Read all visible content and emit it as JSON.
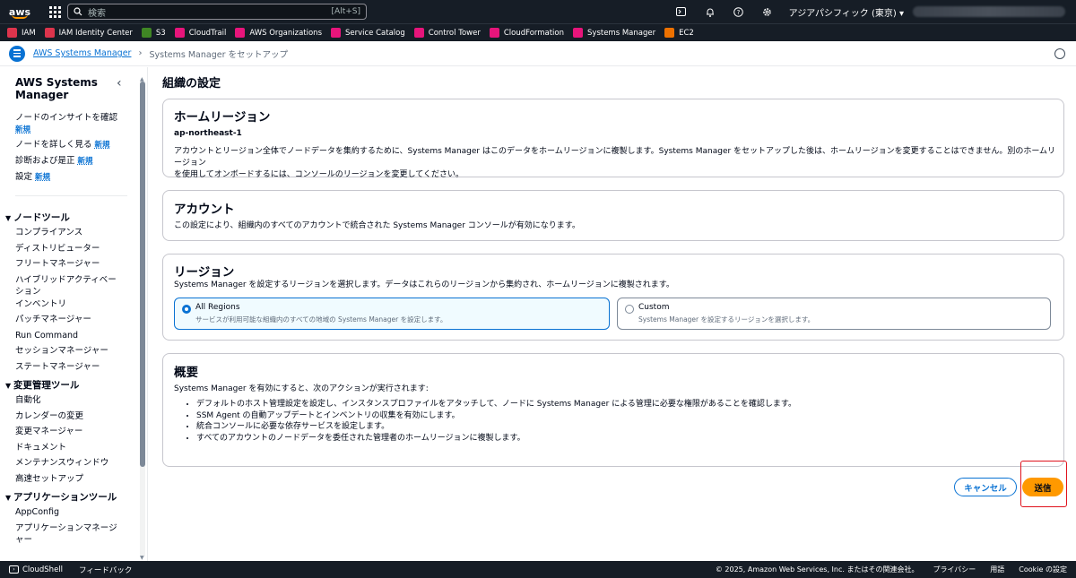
{
  "topbar": {
    "logo": "aws",
    "search_placeholder": "検索",
    "search_shortcut": "[Alt+S]",
    "region": "アジアパシフィック (東京) ▾",
    "icons": [
      "cloudshell-icon",
      "bell-icon",
      "help-icon",
      "gear-icon"
    ]
  },
  "favorites": [
    {
      "label": "IAM",
      "color": "#dd344c"
    },
    {
      "label": "IAM Identity Center",
      "color": "#dd344c"
    },
    {
      "label": "S3",
      "color": "#3f8624"
    },
    {
      "label": "CloudTrail",
      "color": "#e7157b"
    },
    {
      "label": "AWS Organizations",
      "color": "#e7157b"
    },
    {
      "label": "Service Catalog",
      "color": "#e7157b"
    },
    {
      "label": "Control Tower",
      "color": "#e7157b"
    },
    {
      "label": "CloudFormation",
      "color": "#e7157b"
    },
    {
      "label": "Systems Manager",
      "color": "#e7157b"
    },
    {
      "label": "EC2",
      "color": "#ed7100"
    }
  ],
  "breadcrumb": {
    "link": "AWS Systems Manager",
    "current": "Systems Manager をセットアップ"
  },
  "sidebar": {
    "title": "AWS Systems Manager",
    "new_badge": "新規",
    "top_items": [
      "ノードのインサイトを確認",
      "ノードを詳しく見る",
      "診断および是正",
      "設定"
    ],
    "sections": [
      {
        "title": "ノードツール",
        "items": [
          "コンプライアンス",
          "ディストリビューター",
          "フリートマネージャー",
          "ハイブリッドアクティベーション",
          "インベントリ",
          "パッチマネージャー",
          "Run Command",
          "セッションマネージャー",
          "ステートマネージャー"
        ]
      },
      {
        "title": "変更管理ツール",
        "items": [
          "自動化",
          "カレンダーの変更",
          "変更マネージャー",
          "ドキュメント",
          "メンテナンスウィンドウ",
          "高速セットアップ"
        ]
      },
      {
        "title": "アプリケーションツール",
        "items": [
          "AppConfig",
          "アプリケーションマネージャー"
        ]
      }
    ]
  },
  "main": {
    "title": "組織の設定",
    "home_region": {
      "heading": "ホームリージョン",
      "value": "ap-northeast-1",
      "desc1": "アカウントとリージョン全体でノードデータを集約するために、Systems Manager はこのデータをホームリージョンに複製します。Systems Manager をセットアップした後は、ホームリージョンを変更することはできません。別のホームリージョン",
      "desc2": "を使用してオンボードするには、コンソールのリージョンを変更してください。"
    },
    "account": {
      "heading": "アカウント",
      "desc": "この設定により、組織内のすべてのアカウントで統合された Systems Manager コンソールが有効になります。"
    },
    "region": {
      "heading": "リージョン",
      "desc": "Systems Manager を設定するリージョンを選択します。データはこれらのリージョンから集約され、ホームリージョンに複製されます。",
      "options": [
        {
          "label": "All Regions",
          "desc": "サービスが利用可能な組織内のすべての地域の Systems Manager を設定します。",
          "selected": true
        },
        {
          "label": "Custom",
          "desc": "Systems Manager を設定するリージョンを選択します。",
          "selected": false
        }
      ]
    },
    "summary": {
      "heading": "概要",
      "intro": "Systems Manager を有効にすると、次のアクションが実行されます:",
      "bullets": [
        "デフォルトのホスト管理設定を設定し、インスタンスプロファイルをアタッチして、ノードに Systems Manager による管理に必要な権限があることを確認します。",
        "SSM Agent の自動アップデートとインベントリの収集を有効にします。",
        "統合コンソールに必要な依存サービスを設定します。",
        "すべてのアカウントのノードデータを委任された管理者のホームリージョンに複製します。"
      ]
    },
    "cancel": "キャンセル",
    "submit": "送信"
  },
  "footer": {
    "cloudshell": "CloudShell",
    "feedback": "フィードバック",
    "copyright": "© 2025, Amazon Web Services, Inc. またはその関連会社。",
    "privacy": "プライバシー",
    "terms": "用語",
    "cookie": "Cookie の設定"
  }
}
